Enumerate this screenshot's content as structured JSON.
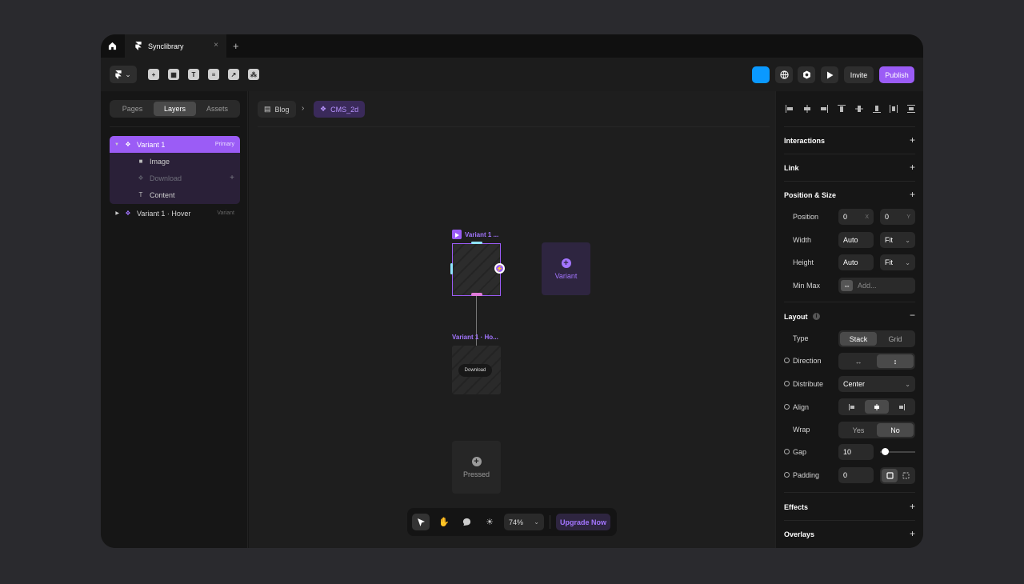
{
  "tabbar": {
    "home_icon": "home-icon",
    "tab_title": "Synclibrary",
    "close_glyph": "×",
    "add_glyph": "+"
  },
  "toolbar": {
    "tools": [
      "insert-icon",
      "layout-icon",
      "text-icon",
      "cms-icon",
      "link-icon",
      "components-icon"
    ],
    "accent_color": "#0a99ff",
    "invite_label": "Invite",
    "publish_label": "Publish",
    "publish_color": "#9b5cf6"
  },
  "left_panel": {
    "tabs": [
      "Pages",
      "Layers",
      "Assets"
    ],
    "active_tab": "Layers",
    "layers": [
      {
        "label": "Variant 1",
        "badge": "Primary",
        "selected": true
      },
      {
        "label": "Image"
      },
      {
        "label": "Download",
        "dimmed": true
      },
      {
        "label": "Content"
      },
      {
        "label": "Variant 1 · Hover",
        "badge": "Variant"
      }
    ]
  },
  "canvas": {
    "breadcrumb": [
      "Blog",
      "CMS_2d"
    ],
    "breadcrumb_sep": "›",
    "primary_label": "Variant 1 ...",
    "hover_label": "Variant 1 · Ho...",
    "download_label": "Download",
    "add_variant_label": "Variant",
    "pressed_label": "Pressed",
    "zoom": "74%",
    "upgrade_label": "Upgrade Now"
  },
  "right_panel": {
    "interactions": "Interactions",
    "link": "Link",
    "position_size": "Position & Size",
    "position_label": "Position",
    "position_x": "0",
    "position_x_suffix": "X",
    "position_y": "0",
    "position_y_suffix": "Y",
    "width_label": "Width",
    "width_value": "Auto",
    "width_mode": "Fit",
    "height_label": "Height",
    "height_value": "Auto",
    "height_mode": "Fit",
    "minmax_label": "Min Max",
    "minmax_placeholder": "Add...",
    "layout": "Layout",
    "type_label": "Type",
    "type_options": [
      "Stack",
      "Grid"
    ],
    "direction_label": "Direction",
    "distribute_label": "Distribute",
    "distribute_value": "Center",
    "align_label": "Align",
    "wrap_label": "Wrap",
    "wrap_options": [
      "Yes",
      "No"
    ],
    "gap_label": "Gap",
    "gap_value": "10",
    "padding_label": "Padding",
    "padding_value": "0",
    "effects": "Effects",
    "overlays": "Overlays"
  }
}
